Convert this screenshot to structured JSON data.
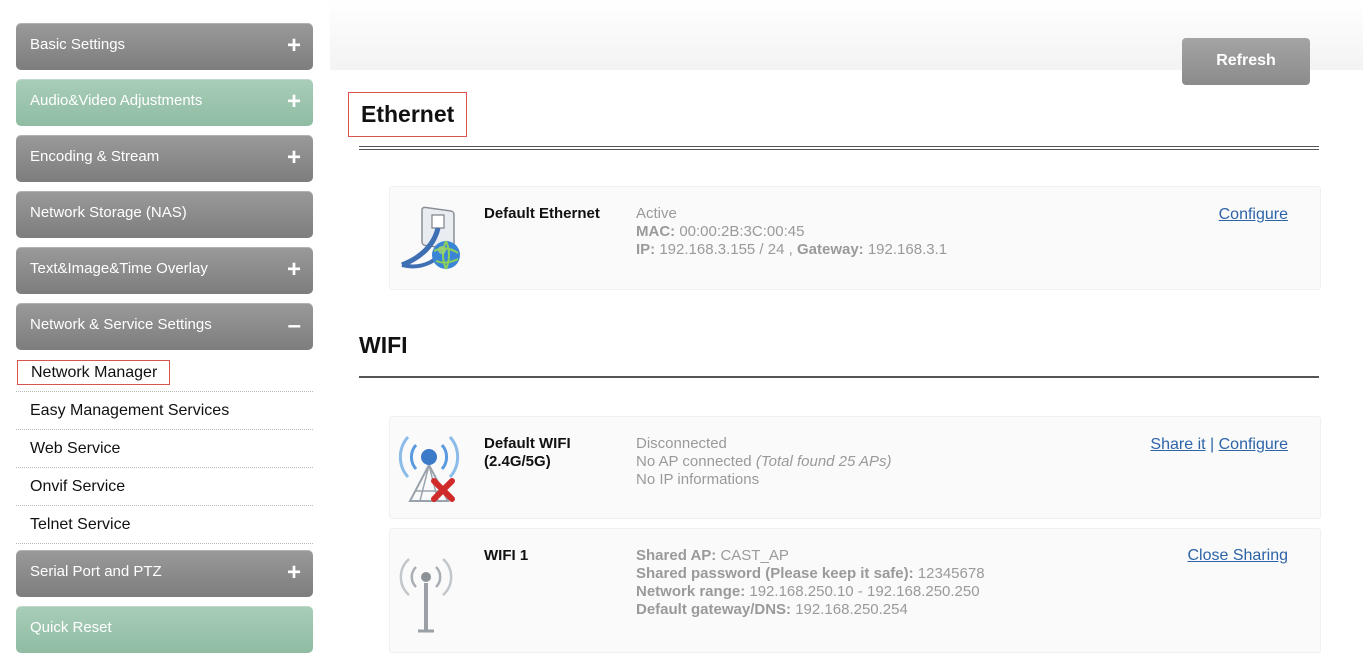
{
  "sidebar": {
    "items": [
      {
        "label": "Basic Settings",
        "toggle": "+",
        "color": "#8a8a8a"
      },
      {
        "label": "Audio&Video Adjustments",
        "toggle": "+",
        "color": "#9ec6ae"
      },
      {
        "label": "Encoding & Stream",
        "toggle": "+",
        "color": "#8a8a8a"
      },
      {
        "label": "Network Storage (NAS)",
        "toggle": "",
        "color": "#8a8a8a"
      },
      {
        "label": "Text&Image&Time Overlay",
        "toggle": "+",
        "color": "#8a8a8a"
      },
      {
        "label": "Network & Service Settings",
        "toggle": "–",
        "color": "#8a8a8a"
      }
    ],
    "sub_items": [
      {
        "label": "Network Manager",
        "selected": true
      },
      {
        "label": "Easy Management Services"
      },
      {
        "label": "Web Service"
      },
      {
        "label": "Onvif Service"
      },
      {
        "label": "Telnet Service"
      }
    ],
    "bottom_items": [
      {
        "label": "Serial Port and PTZ",
        "toggle": "+",
        "color": "#8a8a8a"
      },
      {
        "label": "Quick Reset",
        "toggle": "",
        "color": "#9ec6ae"
      }
    ]
  },
  "toolbar": {
    "refresh_label": "Refresh"
  },
  "ethernet": {
    "title": "Ethernet",
    "card": {
      "icon": "ethernet-globe-icon",
      "name": "Default Ethernet",
      "status": "Active",
      "mac_label": "MAC:",
      "mac_value": "00:00:2B:3C:00:45",
      "ip_label": "IP:",
      "ip_value": "192.168.3.155 / 24 ,",
      "gateway_label": "Gateway:",
      "gateway_value": "192.168.3.1",
      "configure_label": "Configure"
    }
  },
  "wifi": {
    "title": "WIFI",
    "default_card": {
      "icon": "wifi-disconnected-icon",
      "name": "Default WIFI (2.4G/5G)",
      "status": "Disconnected",
      "ap_text": "No AP connected",
      "ap_found": "(Total found 25 APs)",
      "ip_text": "No IP informations",
      "share_label": "Share it",
      "separator": "|",
      "configure_label": "Configure"
    },
    "wifi1_card": {
      "icon": "wifi-antenna-icon",
      "name": "WIFI 1",
      "shared_ap_label": "Shared AP:",
      "shared_ap_value": "CAST_AP",
      "password_label": "Shared password (Please keep it safe):",
      "password_value": "12345678",
      "range_label": "Network range:",
      "range_value": "192.168.250.10 - 192.168.250.250",
      "gateway_label": "Default gateway/DNS:",
      "gateway_value": "192.168.250.254",
      "close_label": "Close Sharing"
    }
  }
}
